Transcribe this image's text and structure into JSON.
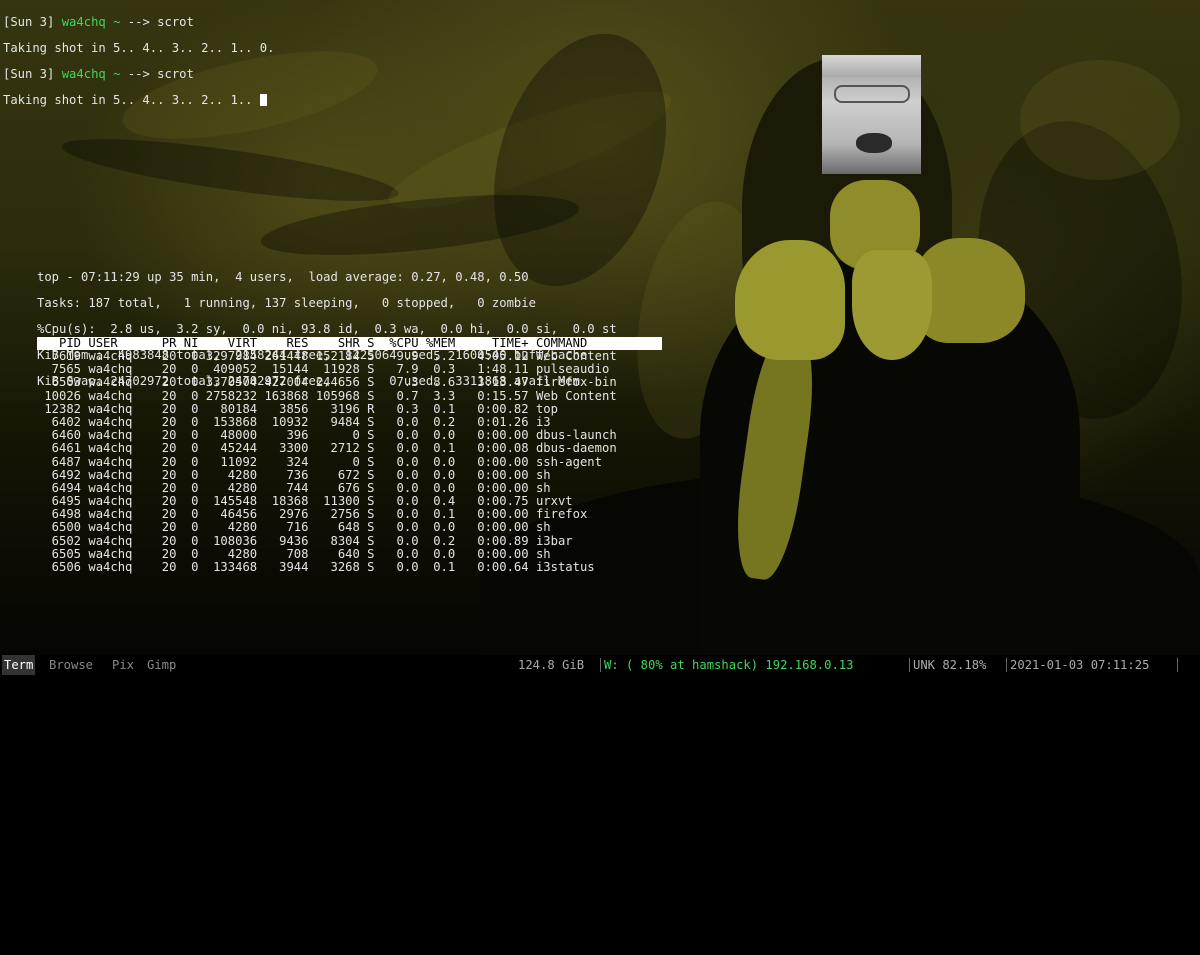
{
  "shell": {
    "lines": [
      {
        "bracket": "[Sun 3]",
        "user": "wa4chq",
        "path": "~",
        "arrow": "-->",
        "cmd": "scrot"
      },
      {
        "text": "Taking shot in 5.. 4.. 3.. 2.. 1.. 0."
      },
      {
        "bracket": "[Sun 3]",
        "user": "wa4chq",
        "path": "~",
        "arrow": "-->",
        "cmd": "scrot"
      },
      {
        "text": "Taking shot in 5.. 4.. 3.. 2.. 1.. "
      }
    ]
  },
  "top": {
    "summary": [
      "top - 07:11:29 up 35 min,  4 users,  load average: 0.27, 0.48, 0.50",
      "Tasks: 187 total,   1 running, 137 sleeping,   0 stopped,   0 zombie",
      "%Cpu(s):  2.8 us,  3.2 sy,  0.0 ni, 93.8 id,  0.3 wa,  0.0 hi,  0.0 si,  0.0 st",
      "KiB Mem :  4983848 total,  2158244 free,  1225064 used,  1600540 buff/cache",
      "KiB Swap: 24702972 total, 24702972 free,        0 used.  3311868 avail Mem"
    ],
    "columns": [
      "PID",
      "USER",
      "PR",
      "NI",
      "VIRT",
      "RES",
      "SHR",
      "S",
      "%CPU",
      "%MEM",
      "TIME+",
      "COMMAND"
    ],
    "rows": [
      [
        "7619",
        "wa4chq",
        "20",
        "0",
        "3297984",
        "261448",
        "152184",
        "S",
        "9.9",
        "5.2",
        "4:05.12",
        "Web Content"
      ],
      [
        "7565",
        "wa4chq",
        "20",
        "0",
        "409052",
        "15144",
        "11928",
        "S",
        "7.9",
        "0.3",
        "1:48.11",
        "pulseaudio"
      ],
      [
        "6503",
        "wa4chq",
        "20",
        "0",
        "3370504",
        "427004",
        "244656",
        "S",
        "7.3",
        "8.6",
        "3:13.47",
        "firefox-bin"
      ],
      [
        "10026",
        "wa4chq",
        "20",
        "0",
        "2758232",
        "163868",
        "105968",
        "S",
        "0.7",
        "3.3",
        "0:15.57",
        "Web Content"
      ],
      [
        "12382",
        "wa4chq",
        "20",
        "0",
        "80184",
        "3856",
        "3196",
        "R",
        "0.3",
        "0.1",
        "0:00.82",
        "top"
      ],
      [
        "6402",
        "wa4chq",
        "20",
        "0",
        "153868",
        "10932",
        "9484",
        "S",
        "0.0",
        "0.2",
        "0:01.26",
        "i3"
      ],
      [
        "6460",
        "wa4chq",
        "20",
        "0",
        "48000",
        "396",
        "0",
        "S",
        "0.0",
        "0.0",
        "0:00.00",
        "dbus-launch"
      ],
      [
        "6461",
        "wa4chq",
        "20",
        "0",
        "45244",
        "3300",
        "2712",
        "S",
        "0.0",
        "0.1",
        "0:00.08",
        "dbus-daemon"
      ],
      [
        "6487",
        "wa4chq",
        "20",
        "0",
        "11092",
        "324",
        "0",
        "S",
        "0.0",
        "0.0",
        "0:00.00",
        "ssh-agent"
      ],
      [
        "6492",
        "wa4chq",
        "20",
        "0",
        "4280",
        "736",
        "672",
        "S",
        "0.0",
        "0.0",
        "0:00.00",
        "sh"
      ],
      [
        "6494",
        "wa4chq",
        "20",
        "0",
        "4280",
        "744",
        "676",
        "S",
        "0.0",
        "0.0",
        "0:00.00",
        "sh"
      ],
      [
        "6495",
        "wa4chq",
        "20",
        "0",
        "145548",
        "18368",
        "11300",
        "S",
        "0.0",
        "0.4",
        "0:00.75",
        "urxvt"
      ],
      [
        "6498",
        "wa4chq",
        "20",
        "0",
        "46456",
        "2976",
        "2756",
        "S",
        "0.0",
        "0.1",
        "0:00.00",
        "firefox"
      ],
      [
        "6500",
        "wa4chq",
        "20",
        "0",
        "4280",
        "716",
        "648",
        "S",
        "0.0",
        "0.0",
        "0:00.00",
        "sh"
      ],
      [
        "6502",
        "wa4chq",
        "20",
        "0",
        "108036",
        "9436",
        "8304",
        "S",
        "0.0",
        "0.2",
        "0:00.89",
        "i3bar"
      ],
      [
        "6505",
        "wa4chq",
        "20",
        "0",
        "4280",
        "708",
        "640",
        "S",
        "0.0",
        "0.0",
        "0:00.00",
        "sh"
      ],
      [
        "6506",
        "wa4chq",
        "20",
        "0",
        "133468",
        "3944",
        "3268",
        "S",
        "0.0",
        "0.1",
        "0:00.64",
        "i3status"
      ]
    ]
  },
  "statusbar": {
    "workspaces": [
      "Term",
      "Browse",
      "Pix",
      "Gimp"
    ],
    "active_workspace": "Term",
    "disk": "124.8 GiB",
    "wifi": "W: ( 80% at hamshack) 192.168.0.13",
    "battery": "UNK 82.18%",
    "clock": "2021-01-03 07:11:25",
    "lock_icon": "lock-icon"
  },
  "colors": {
    "prompt_green": "#3fd85a",
    "status_green": "#3fd85a",
    "status_gray": "#aaaaaa",
    "terminal_text": "#e4e4e4"
  }
}
